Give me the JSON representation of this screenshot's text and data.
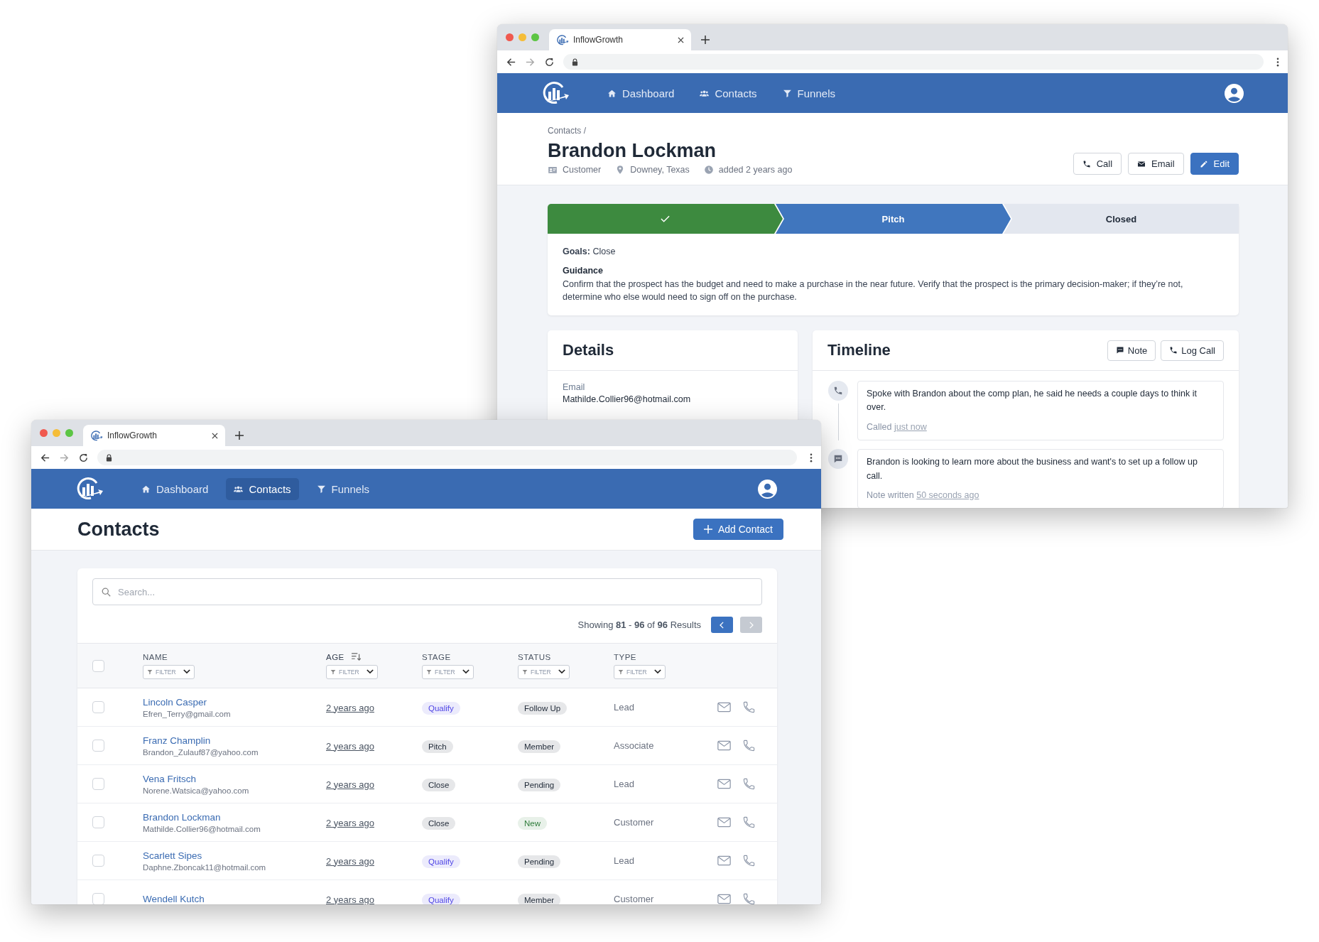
{
  "detail_window": {
    "browser_tab": {
      "title": "InflowGrowth"
    },
    "nav_items": [
      {
        "kind": "home",
        "label": "Dashboard",
        "selected": false
      },
      {
        "kind": "contacts",
        "label": "Contacts",
        "selected": false
      },
      {
        "kind": "funnel",
        "label": "Funnels",
        "selected": false
      }
    ],
    "breadcrumb": "Contacts /",
    "title": "Brandon Lockman",
    "meta": [
      {
        "kind": "type",
        "text": "Customer"
      },
      {
        "kind": "location",
        "text": "Downey, Texas"
      },
      {
        "kind": "time",
        "text": "added 2 years ago"
      }
    ],
    "actions": [
      {
        "kind": "call",
        "label": "Call",
        "primary": false
      },
      {
        "kind": "email",
        "label": "Email",
        "primary": false
      },
      {
        "kind": "edit",
        "label": "Edit",
        "primary": true
      }
    ],
    "stages": [
      {
        "completed": true,
        "selected": false
      },
      {
        "label": "Pitch",
        "completed": false,
        "selected": true
      },
      {
        "label": "Closed",
        "completed": false,
        "selected": false
      }
    ],
    "goals": "**Goals:** Close",
    "guidance_title": "Guidance",
    "guidance": "Confirm that the prospect has the budget and need to make a purchase in the near future. Verify that the prospect is the primary decision-maker; if they’re not, determine who else would need to sign off on the purchase.",
    "details": {
      "title": "Details",
      "fields": [
        {
          "label": "Email",
          "value": "Mathilde.Collier96@hotmail.com"
        }
      ]
    },
    "timeline": {
      "title": "Timeline",
      "buttons": [
        {
          "kind": "note",
          "label": "Note"
        },
        {
          "kind": "call",
          "label": "Log Call"
        }
      ],
      "entries": [
        {
          "kind": "call",
          "text": "Spoke with Brandon about the comp plan, he said he needs a couple days to think it over.",
          "meta": "Called",
          "time": "just now"
        },
        {
          "kind": "note",
          "text": "Brandon is looking to learn more about the business and want's to set up a follow up call.",
          "meta": "Note written",
          "time": "50 seconds ago"
        }
      ]
    }
  },
  "contacts_window": {
    "browser_tab": {
      "title": "InflowGrowth"
    },
    "nav_items": [
      {
        "kind": "home",
        "label": "Dashboard",
        "selected": false
      },
      {
        "kind": "contacts",
        "label": "Contacts",
        "selected": true
      },
      {
        "kind": "funnel",
        "label": "Funnels",
        "selected": false
      }
    ],
    "title": "Contacts",
    "add_button": "Add Contact",
    "search": {
      "placeholder": "Search..."
    },
    "results": "Showing **81** - **96** of **96** Results",
    "pagination": [
      {
        "kind": "prev",
        "disabled": false
      },
      {
        "kind": "next",
        "disabled": true
      }
    ],
    "all_checked": false,
    "columns": [
      {
        "label": "NAME",
        "sorted": false,
        "filter": "FILTER"
      },
      {
        "label": "AGE",
        "sorted": true,
        "filter": "FILTER"
      },
      {
        "label": "STAGE",
        "sorted": false,
        "filter": "FILTER"
      },
      {
        "label": "STATUS",
        "sorted": false,
        "filter": "FILTER"
      },
      {
        "label": "TYPE",
        "sorted": false,
        "filter": "FILTER"
      }
    ],
    "rows": [
      {
        "checked": false,
        "name": "Lincoln Casper",
        "email": "Efren_Terry@gmail.com",
        "age": "2 years ago",
        "stage": {
          "label": "Qualify",
          "color": "#5046e5"
        },
        "status": {
          "label": "Follow Up",
          "color": "#1f2937"
        },
        "type": "Lead"
      },
      {
        "checked": false,
        "name": "Franz Champlin",
        "email": "Brandon_Zulauf87@yahoo.com",
        "age": "2 years ago",
        "stage": {
          "label": "Pitch",
          "color": "#1f2937"
        },
        "status": {
          "label": "Member",
          "color": "#1f2937"
        },
        "type": "Associate"
      },
      {
        "checked": false,
        "name": "Vena Fritsch",
        "email": "Norene.Watsica@yahoo.com",
        "age": "2 years ago",
        "stage": {
          "label": "Close",
          "color": "#1f2937"
        },
        "status": {
          "label": "Pending",
          "color": "#1f2937"
        },
        "type": "Lead"
      },
      {
        "checked": false,
        "name": "Brandon Lockman",
        "email": "Mathilde.Collier96@hotmail.com",
        "age": "2 years ago",
        "stage": {
          "label": "Close",
          "color": "#1f2937"
        },
        "status": {
          "label": "New",
          "color": "#2f7d3b"
        },
        "type": "Customer"
      },
      {
        "checked": false,
        "name": "Scarlett Sipes",
        "email": "Daphne.Zboncak11@hotmail.com",
        "age": "2 years ago",
        "stage": {
          "label": "Qualify",
          "color": "#5046e5"
        },
        "status": {
          "label": "Pending",
          "color": "#1f2937"
        },
        "type": "Lead"
      },
      {
        "checked": false,
        "name": "Wendell Kutch",
        "age": "2 years ago",
        "stage": {
          "label": "Qualify",
          "color": "#5046e5"
        },
        "status": {
          "label": "Member",
          "color": "#1f2937"
        },
        "type": "Customer"
      }
    ]
  }
}
